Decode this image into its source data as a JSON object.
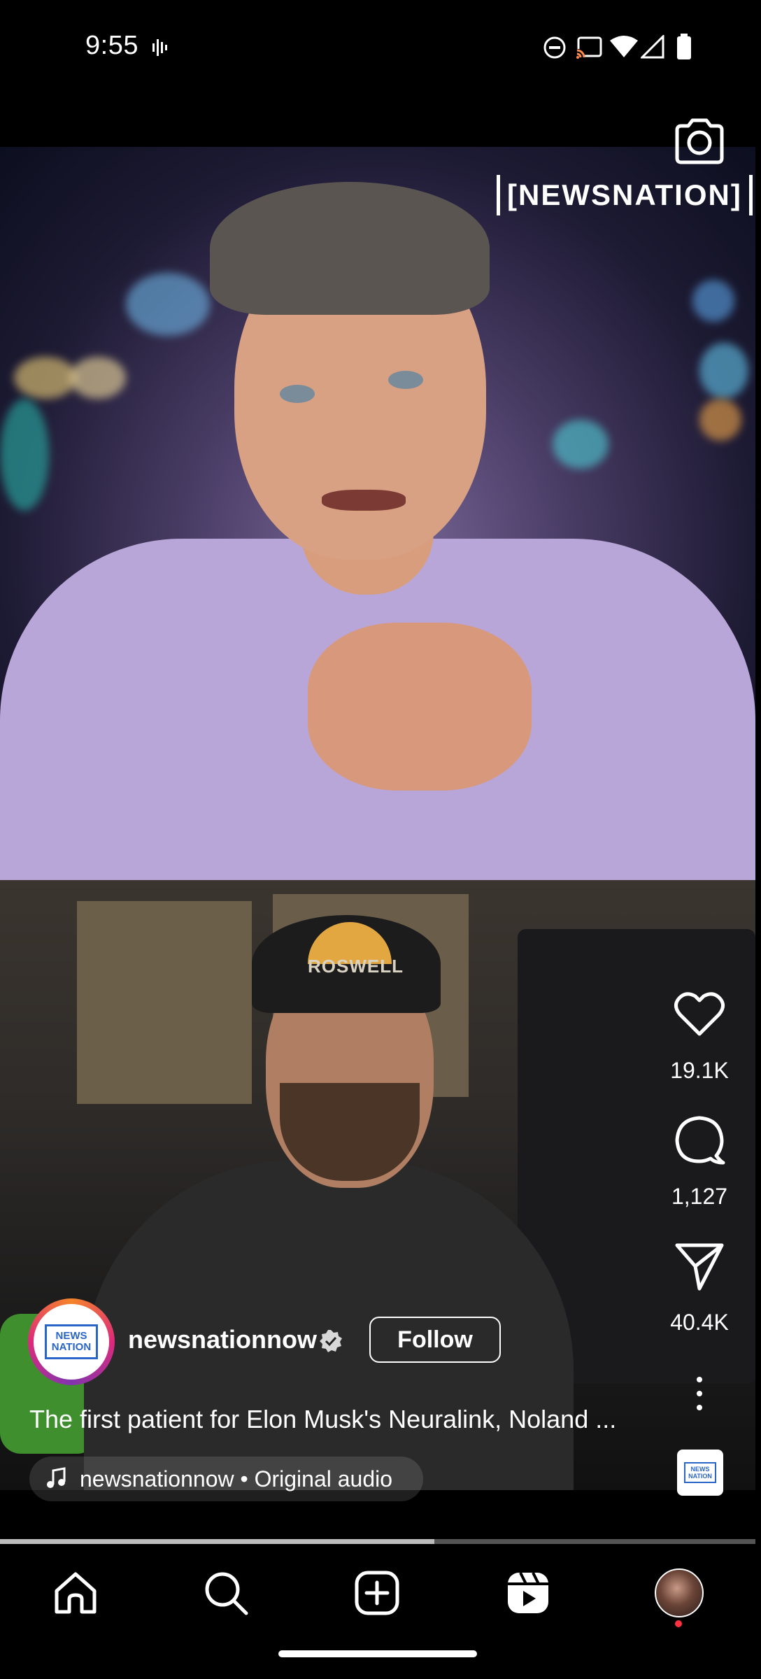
{
  "status_bar": {
    "time": "9:55",
    "icons": [
      "sound-wave-icon",
      "do-not-disturb-icon",
      "cast-icon",
      "wifi-icon",
      "cellular-signal-icon",
      "battery-icon"
    ]
  },
  "video": {
    "channel_watermark": "[NEWSNATION]",
    "top_clip_hat_text": "ROSWELL"
  },
  "camera_button": "camera-icon",
  "actions": {
    "likes": "19.1K",
    "comments": "1,127",
    "shares": "40.4K"
  },
  "author": {
    "avatar_text_line1": "NEWS",
    "avatar_text_line2": "NATION",
    "username": "newsnationnow",
    "verified": true,
    "follow_label": "Follow"
  },
  "caption": "The first patient for Elon Musk's Neuralink, Noland ...",
  "audio": {
    "label": "newsnationnow • Original audio",
    "thumb_line1": "NEWS",
    "thumb_line2": "NATION"
  },
  "progress": {
    "fraction": 0.575
  },
  "bottom_nav": [
    "home-icon",
    "search-icon",
    "create-icon",
    "reels-icon",
    "profile-avatar"
  ],
  "colors": {
    "background": "#000000",
    "story_ring": [
      "#f58529",
      "#dd2a7b",
      "#8134af"
    ],
    "notification_dot": "#ff3040"
  }
}
